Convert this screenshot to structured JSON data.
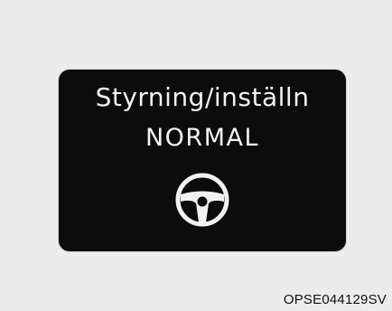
{
  "display": {
    "title": "Styrning/inställn",
    "mode": "NORMAL",
    "icon": "steering-wheel-icon"
  },
  "caption": "OPSE044129SV",
  "colors": {
    "background": "#ececec",
    "panel": "#0c0c0c",
    "text": "#f2f2f2"
  }
}
